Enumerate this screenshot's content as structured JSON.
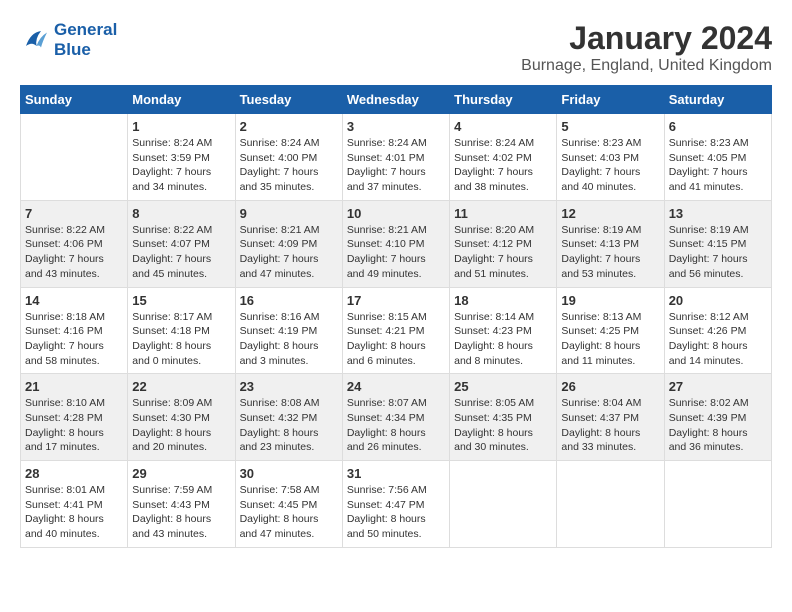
{
  "logo": {
    "line1": "General",
    "line2": "Blue"
  },
  "title": "January 2024",
  "location": "Burnage, England, United Kingdom",
  "days_of_week": [
    "Sunday",
    "Monday",
    "Tuesday",
    "Wednesday",
    "Thursday",
    "Friday",
    "Saturday"
  ],
  "weeks": [
    [
      {
        "date": "",
        "info": ""
      },
      {
        "date": "1",
        "info": "Sunrise: 8:24 AM\nSunset: 3:59 PM\nDaylight: 7 hours\nand 34 minutes."
      },
      {
        "date": "2",
        "info": "Sunrise: 8:24 AM\nSunset: 4:00 PM\nDaylight: 7 hours\nand 35 minutes."
      },
      {
        "date": "3",
        "info": "Sunrise: 8:24 AM\nSunset: 4:01 PM\nDaylight: 7 hours\nand 37 minutes."
      },
      {
        "date": "4",
        "info": "Sunrise: 8:24 AM\nSunset: 4:02 PM\nDaylight: 7 hours\nand 38 minutes."
      },
      {
        "date": "5",
        "info": "Sunrise: 8:23 AM\nSunset: 4:03 PM\nDaylight: 7 hours\nand 40 minutes."
      },
      {
        "date": "6",
        "info": "Sunrise: 8:23 AM\nSunset: 4:05 PM\nDaylight: 7 hours\nand 41 minutes."
      }
    ],
    [
      {
        "date": "7",
        "info": "Sunrise: 8:22 AM\nSunset: 4:06 PM\nDaylight: 7 hours\nand 43 minutes."
      },
      {
        "date": "8",
        "info": "Sunrise: 8:22 AM\nSunset: 4:07 PM\nDaylight: 7 hours\nand 45 minutes."
      },
      {
        "date": "9",
        "info": "Sunrise: 8:21 AM\nSunset: 4:09 PM\nDaylight: 7 hours\nand 47 minutes."
      },
      {
        "date": "10",
        "info": "Sunrise: 8:21 AM\nSunset: 4:10 PM\nDaylight: 7 hours\nand 49 minutes."
      },
      {
        "date": "11",
        "info": "Sunrise: 8:20 AM\nSunset: 4:12 PM\nDaylight: 7 hours\nand 51 minutes."
      },
      {
        "date": "12",
        "info": "Sunrise: 8:19 AM\nSunset: 4:13 PM\nDaylight: 7 hours\nand 53 minutes."
      },
      {
        "date": "13",
        "info": "Sunrise: 8:19 AM\nSunset: 4:15 PM\nDaylight: 7 hours\nand 56 minutes."
      }
    ],
    [
      {
        "date": "14",
        "info": "Sunrise: 8:18 AM\nSunset: 4:16 PM\nDaylight: 7 hours\nand 58 minutes."
      },
      {
        "date": "15",
        "info": "Sunrise: 8:17 AM\nSunset: 4:18 PM\nDaylight: 8 hours\nand 0 minutes."
      },
      {
        "date": "16",
        "info": "Sunrise: 8:16 AM\nSunset: 4:19 PM\nDaylight: 8 hours\nand 3 minutes."
      },
      {
        "date": "17",
        "info": "Sunrise: 8:15 AM\nSunset: 4:21 PM\nDaylight: 8 hours\nand 6 minutes."
      },
      {
        "date": "18",
        "info": "Sunrise: 8:14 AM\nSunset: 4:23 PM\nDaylight: 8 hours\nand 8 minutes."
      },
      {
        "date": "19",
        "info": "Sunrise: 8:13 AM\nSunset: 4:25 PM\nDaylight: 8 hours\nand 11 minutes."
      },
      {
        "date": "20",
        "info": "Sunrise: 8:12 AM\nSunset: 4:26 PM\nDaylight: 8 hours\nand 14 minutes."
      }
    ],
    [
      {
        "date": "21",
        "info": "Sunrise: 8:10 AM\nSunset: 4:28 PM\nDaylight: 8 hours\nand 17 minutes."
      },
      {
        "date": "22",
        "info": "Sunrise: 8:09 AM\nSunset: 4:30 PM\nDaylight: 8 hours\nand 20 minutes."
      },
      {
        "date": "23",
        "info": "Sunrise: 8:08 AM\nSunset: 4:32 PM\nDaylight: 8 hours\nand 23 minutes."
      },
      {
        "date": "24",
        "info": "Sunrise: 8:07 AM\nSunset: 4:34 PM\nDaylight: 8 hours\nand 26 minutes."
      },
      {
        "date": "25",
        "info": "Sunrise: 8:05 AM\nSunset: 4:35 PM\nDaylight: 8 hours\nand 30 minutes."
      },
      {
        "date": "26",
        "info": "Sunrise: 8:04 AM\nSunset: 4:37 PM\nDaylight: 8 hours\nand 33 minutes."
      },
      {
        "date": "27",
        "info": "Sunrise: 8:02 AM\nSunset: 4:39 PM\nDaylight: 8 hours\nand 36 minutes."
      }
    ],
    [
      {
        "date": "28",
        "info": "Sunrise: 8:01 AM\nSunset: 4:41 PM\nDaylight: 8 hours\nand 40 minutes."
      },
      {
        "date": "29",
        "info": "Sunrise: 7:59 AM\nSunset: 4:43 PM\nDaylight: 8 hours\nand 43 minutes."
      },
      {
        "date": "30",
        "info": "Sunrise: 7:58 AM\nSunset: 4:45 PM\nDaylight: 8 hours\nand 47 minutes."
      },
      {
        "date": "31",
        "info": "Sunrise: 7:56 AM\nSunset: 4:47 PM\nDaylight: 8 hours\nand 50 minutes."
      },
      {
        "date": "",
        "info": ""
      },
      {
        "date": "",
        "info": ""
      },
      {
        "date": "",
        "info": ""
      }
    ]
  ]
}
